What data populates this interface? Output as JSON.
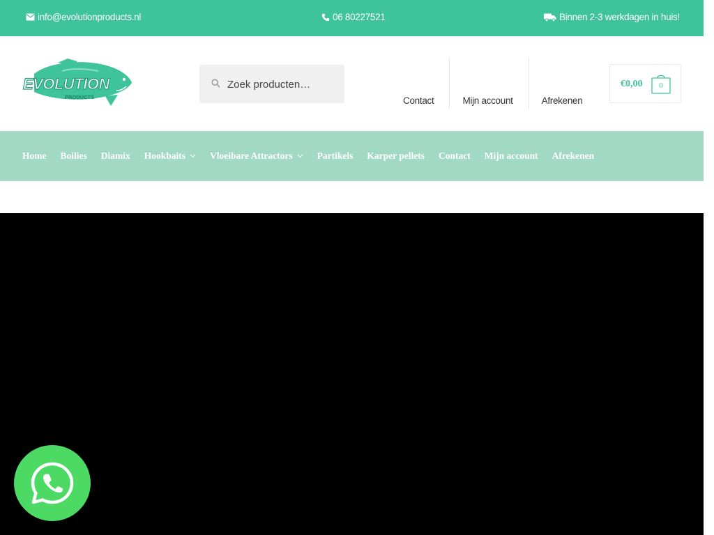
{
  "topbar": {
    "email": "info@evolutionproducts.nl",
    "phone": "06 80227521",
    "delivery": "Binnen 2-3 werkdagen in huis!",
    "icons": [
      "envelope-icon",
      "phone-icon",
      "truck-icon"
    ]
  },
  "brand": {
    "logo_text": "EVOLUTION",
    "logo_subtext": "PRODUCTS",
    "color": "#3ec39b"
  },
  "search": {
    "placeholder": "Zoek producten…"
  },
  "header_nav": [
    "Contact",
    "Mijn account",
    "Afrekenen"
  ],
  "cart": {
    "amount": "€0,00",
    "count": "0"
  },
  "main_nav": [
    {
      "label": "Home",
      "dropdown": false
    },
    {
      "label": "Boilies",
      "dropdown": false
    },
    {
      "label": "Diamix",
      "dropdown": false
    },
    {
      "label": "Hookbaits",
      "dropdown": true
    },
    {
      "label": "Vloeibare Attractors",
      "dropdown": true
    },
    {
      "label": "Partikels",
      "dropdown": false
    },
    {
      "label": "Karper pellets",
      "dropdown": false
    },
    {
      "label": "Contact",
      "dropdown": false
    },
    {
      "label": "Mijn account",
      "dropdown": false
    },
    {
      "label": "Afrekenen",
      "dropdown": false
    }
  ],
  "colors": {
    "accent": "#3ec39b",
    "nav_bg": "#a1d9c4",
    "whatsapp": "#4cd964",
    "hero": "#000000"
  }
}
